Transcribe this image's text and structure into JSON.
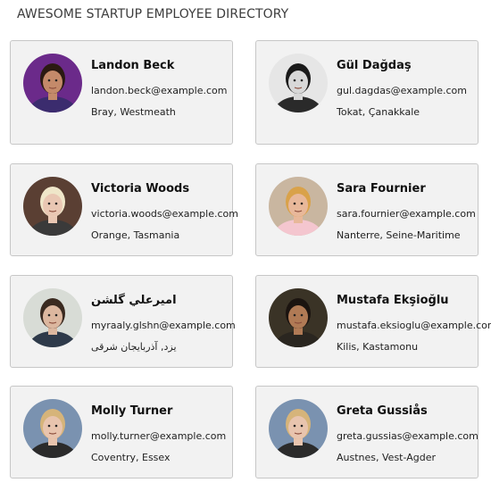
{
  "header": {
    "title": "AWESOME STARTUP EMPLOYEE DIRECTORY"
  },
  "employees": [
    {
      "name": "Landon Beck",
      "email": "landon.beck@example.com",
      "location": "Bray, Westmeath",
      "avatar_colors": {
        "bg": "#6b2a8a",
        "skin": "#c48a6a",
        "hair": "#2b1a12",
        "shirt": "#3b2c6e"
      }
    },
    {
      "name": "Gül Dağdaş",
      "email": "gul.dagdas@example.com",
      "location": "Tokat, Çanakkale",
      "avatar_colors": {
        "bg": "#e6e6e6",
        "skin": "#d8d8d8",
        "hair": "#1a1a1a",
        "shirt": "#2a2a2a"
      }
    },
    {
      "name": "Victoria Woods",
      "email": "victoria.woods@example.com",
      "location": "Orange, Tasmania",
      "avatar_colors": {
        "bg": "#5a3f33",
        "skin": "#e9c7b3",
        "hair": "#efe6c9",
        "shirt": "#3a3a3a"
      }
    },
    {
      "name": "Sara Fournier",
      "email": "sara.fournier@example.com",
      "location": "Nanterre, Seine-Maritime",
      "avatar_colors": {
        "bg": "#c9b6a0",
        "skin": "#e8b89a",
        "hair": "#d9a24a",
        "shirt": "#f4c6cf"
      }
    },
    {
      "name": "اميرعلي گلشن",
      "email": "myraaly.glshn@example.com",
      "location": "یزد, آذربایجان شرقی",
      "avatar_colors": {
        "bg": "#d8dcd6",
        "skin": "#dcb79f",
        "hair": "#3a2a20",
        "shirt": "#2e3a4a"
      }
    },
    {
      "name": "Mustafa Ekşioğlu",
      "email": "mustafa.eksioglu@example.com",
      "location": "Kilis, Kastamonu",
      "avatar_colors": {
        "bg": "#3a3326",
        "skin": "#b07a55",
        "hair": "#1b1410",
        "shirt": "#2a2620"
      }
    },
    {
      "name": "Molly Turner",
      "email": "molly.turner@example.com",
      "location": "Coventry, Essex",
      "avatar_colors": {
        "bg": "#7a92b0",
        "skin": "#e8c4ae",
        "hair": "#d6b47a",
        "shirt": "#2b2b2b"
      }
    },
    {
      "name": "Greta Gussiås",
      "email": "greta.gussias@example.com",
      "location": "Austnes, Vest-Agder",
      "avatar_colors": {
        "bg": "#7a92b0",
        "skin": "#e8c4ae",
        "hair": "#d6b47a",
        "shirt": "#2b2b2b"
      }
    }
  ]
}
